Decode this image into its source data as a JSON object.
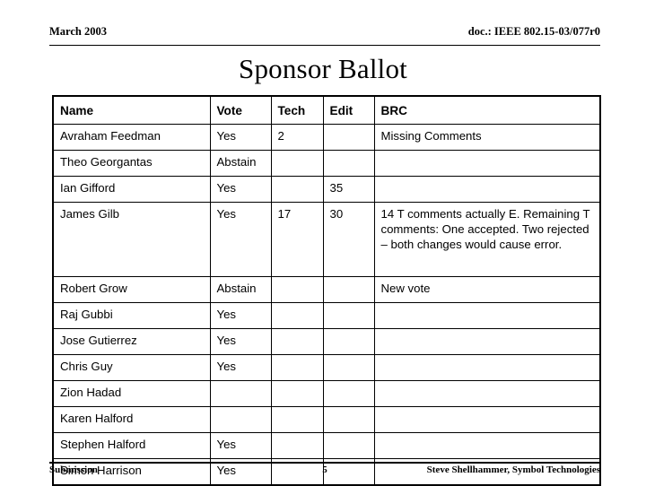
{
  "header": {
    "date": "March 2003",
    "doc_reference": "doc.: IEEE 802.15-03/077r0"
  },
  "title": "Sponsor Ballot",
  "table": {
    "columns": [
      "Name",
      "Vote",
      "Tech",
      "Edit",
      "BRC"
    ],
    "rows": [
      {
        "name": "Avraham Feedman",
        "vote": "Yes",
        "tech": "2",
        "edit": "",
        "brc": "Missing Comments",
        "tall": false
      },
      {
        "name": "Theo Georgantas",
        "vote": "Abstain",
        "tech": "",
        "edit": "",
        "brc": "",
        "tall": false
      },
      {
        "name": "Ian Gifford",
        "vote": "Yes",
        "tech": "",
        "edit": "35",
        "brc": "",
        "tall": false
      },
      {
        "name": "James Gilb",
        "vote": "Yes",
        "tech": "17",
        "edit": "30",
        "brc": "14 T comments actually E. Remaining T comments: One accepted.  Two rejected – both changes would cause error.",
        "tall": true
      },
      {
        "name": "Robert Grow",
        "vote": "Abstain",
        "tech": "",
        "edit": "",
        "brc": "New vote",
        "tall": false
      },
      {
        "name": "Raj Gubbi",
        "vote": "Yes",
        "tech": "",
        "edit": "",
        "brc": "",
        "tall": false
      },
      {
        "name": "Jose Gutierrez",
        "vote": "Yes",
        "tech": "",
        "edit": "",
        "brc": "",
        "tall": false
      },
      {
        "name": "Chris Guy",
        "vote": "Yes",
        "tech": "",
        "edit": "",
        "brc": "",
        "tall": false
      },
      {
        "name": "Zion Hadad",
        "vote": "",
        "tech": "",
        "edit": "",
        "brc": "",
        "tall": false
      },
      {
        "name": "Karen Halford",
        "vote": "",
        "tech": "",
        "edit": "",
        "brc": "",
        "tall": false
      },
      {
        "name": "Stephen Halford",
        "vote": "Yes",
        "tech": "",
        "edit": "",
        "brc": "",
        "tall": false
      },
      {
        "name": "Simon Harrison",
        "vote": "Yes",
        "tech": "",
        "edit": "",
        "brc": "",
        "tall": false
      }
    ]
  },
  "footer": {
    "left": "Submission",
    "page_number": "5",
    "right": "Steve Shellhammer, Symbol Technologies"
  }
}
